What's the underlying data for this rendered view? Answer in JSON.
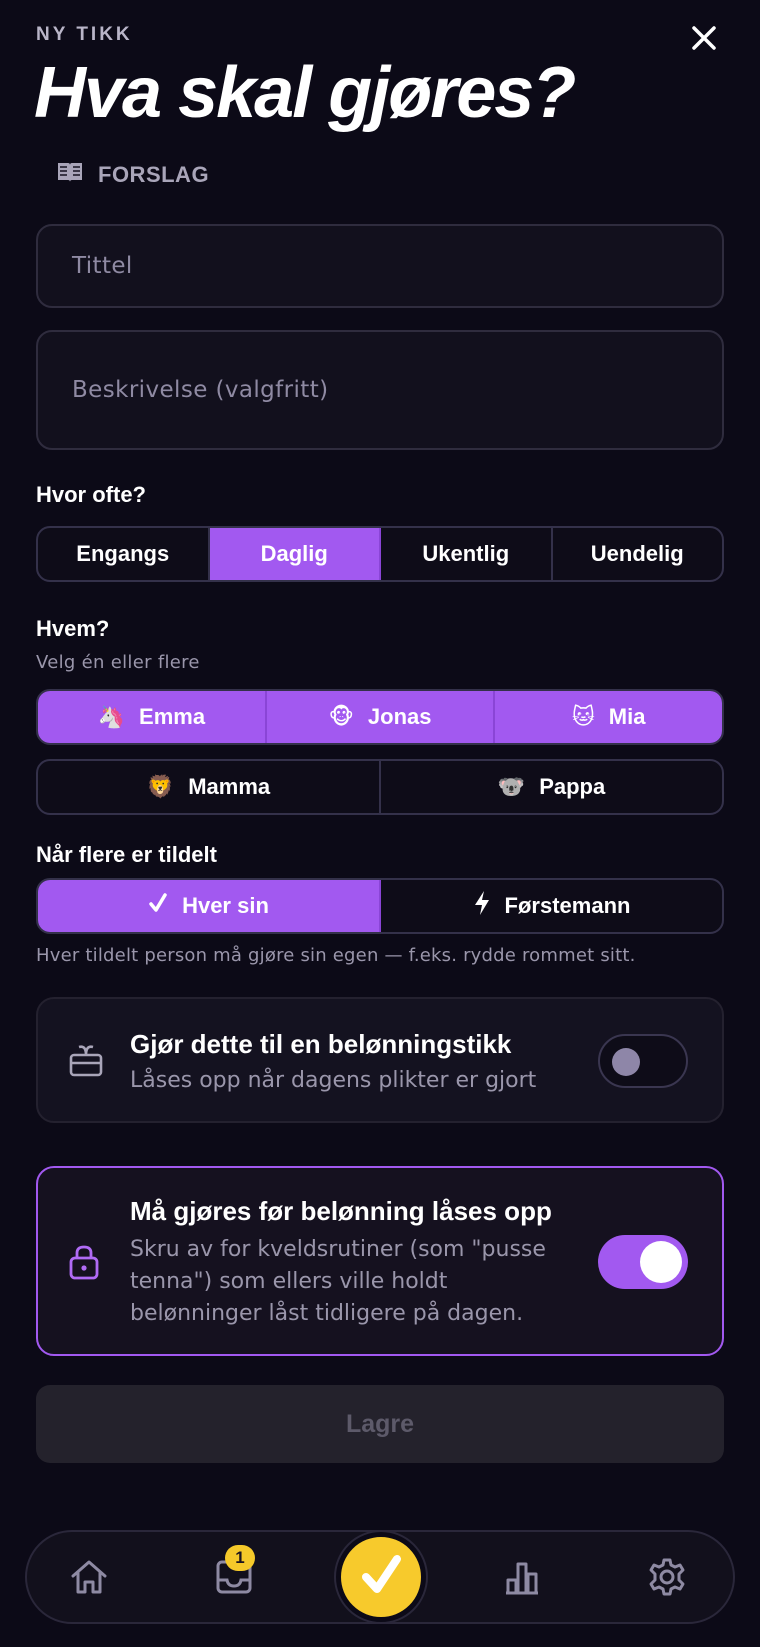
{
  "header": {
    "eyebrow": "NY TIKK",
    "title": "Hva skal gjøres?",
    "suggestions_label": "FORSLAG"
  },
  "form": {
    "title_placeholder": "Tittel",
    "description_placeholder": "Beskrivelse (valgfritt)"
  },
  "frequency": {
    "label": "Hvor ofte?",
    "options": [
      "Engangs",
      "Daglig",
      "Ukentlig",
      "Uendelig"
    ],
    "selected": "Daglig"
  },
  "assignees": {
    "label": "Hvem?",
    "sublabel": "Velg én eller flere",
    "people": [
      {
        "emoji": "🦄",
        "name": "Emma",
        "selected": true
      },
      {
        "emoji": "🐵",
        "name": "Jonas",
        "selected": true
      },
      {
        "emoji": "🐱",
        "name": "Mia",
        "selected": true
      },
      {
        "emoji": "🦁",
        "name": "Mamma",
        "selected": false
      },
      {
        "emoji": "🐨",
        "name": "Pappa",
        "selected": false
      }
    ]
  },
  "mode": {
    "label": "Når flere er tildelt",
    "options": [
      "Hver sin",
      "Førstemann"
    ],
    "selected": "Hver sin",
    "hint": "Hver tildelt person må gjøre sin egen — f.eks. rydde rommet sitt."
  },
  "reward_card": {
    "title": "Gjør dette til en belønningstikk",
    "description": "Låses opp når dagens plikter er gjort",
    "enabled": false
  },
  "required_card": {
    "title": "Må gjøres før belønning låses opp",
    "description_lines": [
      "Skru av for kveldsrutiner (som \"pusse",
      "tenna\") som ellers ville holdt",
      "belønninger låst tidligere på dagen."
    ],
    "enabled": true
  },
  "save_label": "Lagre",
  "tabbar": {
    "inbox_badge": "1",
    "icons": [
      "home-icon",
      "inbox-icon",
      "check-icon",
      "stats-icon",
      "gear-icon"
    ]
  },
  "colors": {
    "accent": "#a259f0",
    "fab": "#f7ca2c",
    "background": "#0c0a17"
  }
}
